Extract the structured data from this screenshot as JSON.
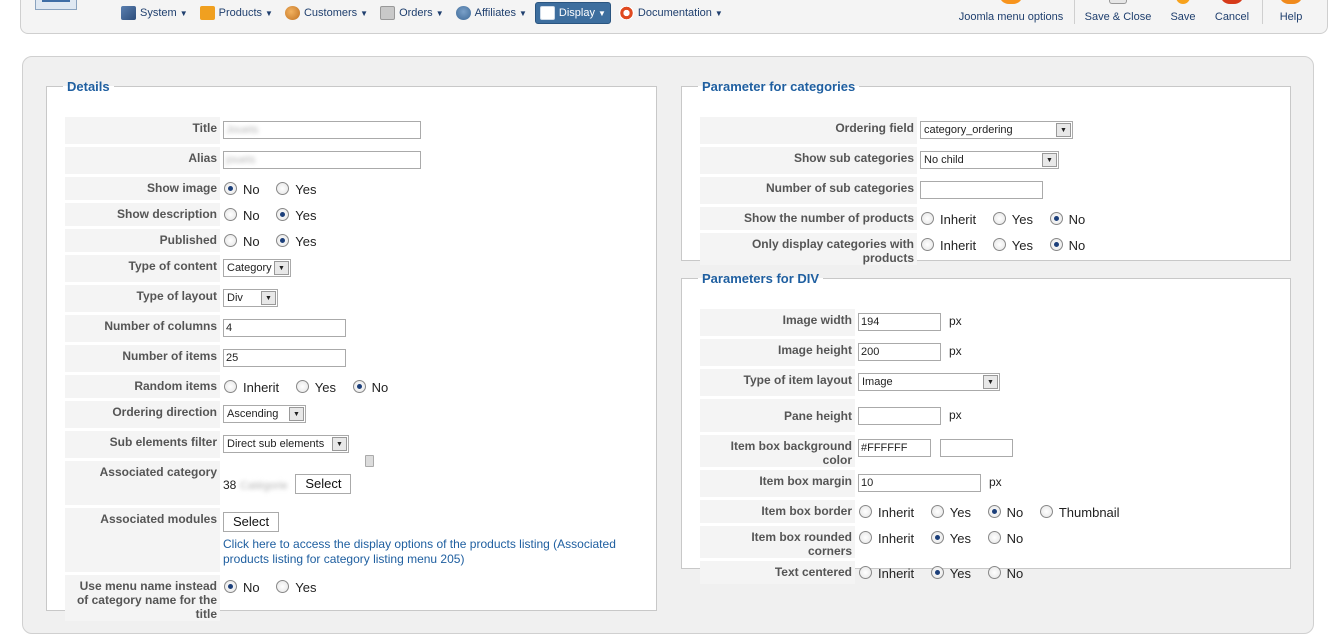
{
  "toolbar": {
    "nav": [
      {
        "label": "System",
        "icon": "tools-icon"
      },
      {
        "label": "Products",
        "icon": "products-icon"
      },
      {
        "label": "Customers",
        "icon": "customers-icon"
      },
      {
        "label": "Orders",
        "icon": "orders-icon"
      },
      {
        "label": "Affiliates",
        "icon": "affiliates-icon"
      },
      {
        "label": "Display",
        "icon": "display-icon",
        "active": true
      },
      {
        "label": "Documentation",
        "icon": "help-ring-icon"
      }
    ],
    "buttons": {
      "joomla_menu_options": "Joomla menu options",
      "save_close": "Save & Close",
      "save": "Save",
      "cancel": "Cancel",
      "help": "Help"
    },
    "accent_color": "#3d6e9e"
  },
  "details": {
    "legend": "Details",
    "title": {
      "label": "Title",
      "value": "Jouets"
    },
    "alias": {
      "label": "Alias",
      "value": "jouets"
    },
    "show_image": {
      "label": "Show image",
      "options": [
        "No",
        "Yes"
      ],
      "selected": "No"
    },
    "show_description": {
      "label": "Show description",
      "options": [
        "No",
        "Yes"
      ],
      "selected": "Yes"
    },
    "published": {
      "label": "Published",
      "options": [
        "No",
        "Yes"
      ],
      "selected": "Yes"
    },
    "type_of_content": {
      "label": "Type of content",
      "value": "Category"
    },
    "type_of_layout": {
      "label": "Type of layout",
      "value": "Div"
    },
    "number_of_columns": {
      "label": "Number of columns",
      "value": "4"
    },
    "number_of_items": {
      "label": "Number of items",
      "value": "25"
    },
    "random_items": {
      "label": "Random items",
      "options": [
        "Inherit",
        "Yes",
        "No"
      ],
      "selected": "No"
    },
    "ordering_direction": {
      "label": "Ordering direction",
      "value": "Ascending"
    },
    "sub_elements_filter": {
      "label": "Sub elements filter",
      "value": "Direct sub elements"
    },
    "associated_category": {
      "label": "Associated category",
      "id": "38",
      "name": "Catégorie",
      "button": "Select"
    },
    "associated_modules": {
      "label": "Associated modules",
      "button": "Select",
      "link": "Click here to access the display options of the products listing (Associated products listing for category listing menu 205)"
    },
    "use_menu_name": {
      "label": "Use menu name instead of category name for the title",
      "options": [
        "No",
        "Yes"
      ],
      "selected": "No"
    }
  },
  "categories": {
    "legend": "Parameter for categories",
    "ordering_field": {
      "label": "Ordering field",
      "value": "category_ordering"
    },
    "show_sub_categories": {
      "label": "Show sub categories",
      "value": "No child"
    },
    "number_of_sub_categories": {
      "label": "Number of sub categories",
      "value": ""
    },
    "show_number_of_products": {
      "label": "Show the number of products",
      "options": [
        "Inherit",
        "Yes",
        "No"
      ],
      "selected": "No"
    },
    "only_display_with_products": {
      "label": "Only display categories with products",
      "options": [
        "Inherit",
        "Yes",
        "No"
      ],
      "selected": "No"
    }
  },
  "div": {
    "legend": "Parameters for DIV",
    "image_width": {
      "label": "Image width",
      "value": "194",
      "unit": "px"
    },
    "image_height": {
      "label": "Image height",
      "value": "200",
      "unit": "px"
    },
    "type_of_item_layout": {
      "label": "Type of item layout",
      "value": "Image"
    },
    "pane_height": {
      "label": "Pane height",
      "value": "",
      "unit": "px"
    },
    "item_box_background_color": {
      "label": "Item box background color",
      "value": "#FFFFFF",
      "swatch": "#FFFFFF"
    },
    "item_box_margin": {
      "label": "Item box margin",
      "value": "10",
      "unit": "px"
    },
    "item_box_border": {
      "label": "Item box border",
      "options": [
        "Inherit",
        "Yes",
        "No",
        "Thumbnail"
      ],
      "selected": "No"
    },
    "item_rounded_corners": {
      "label": "Item box rounded corners",
      "options": [
        "Inherit",
        "Yes",
        "No"
      ],
      "selected": "Yes"
    },
    "text_centered": {
      "label": "Text centered",
      "options": [
        "Inherit",
        "Yes",
        "No"
      ],
      "selected": "Yes"
    }
  }
}
